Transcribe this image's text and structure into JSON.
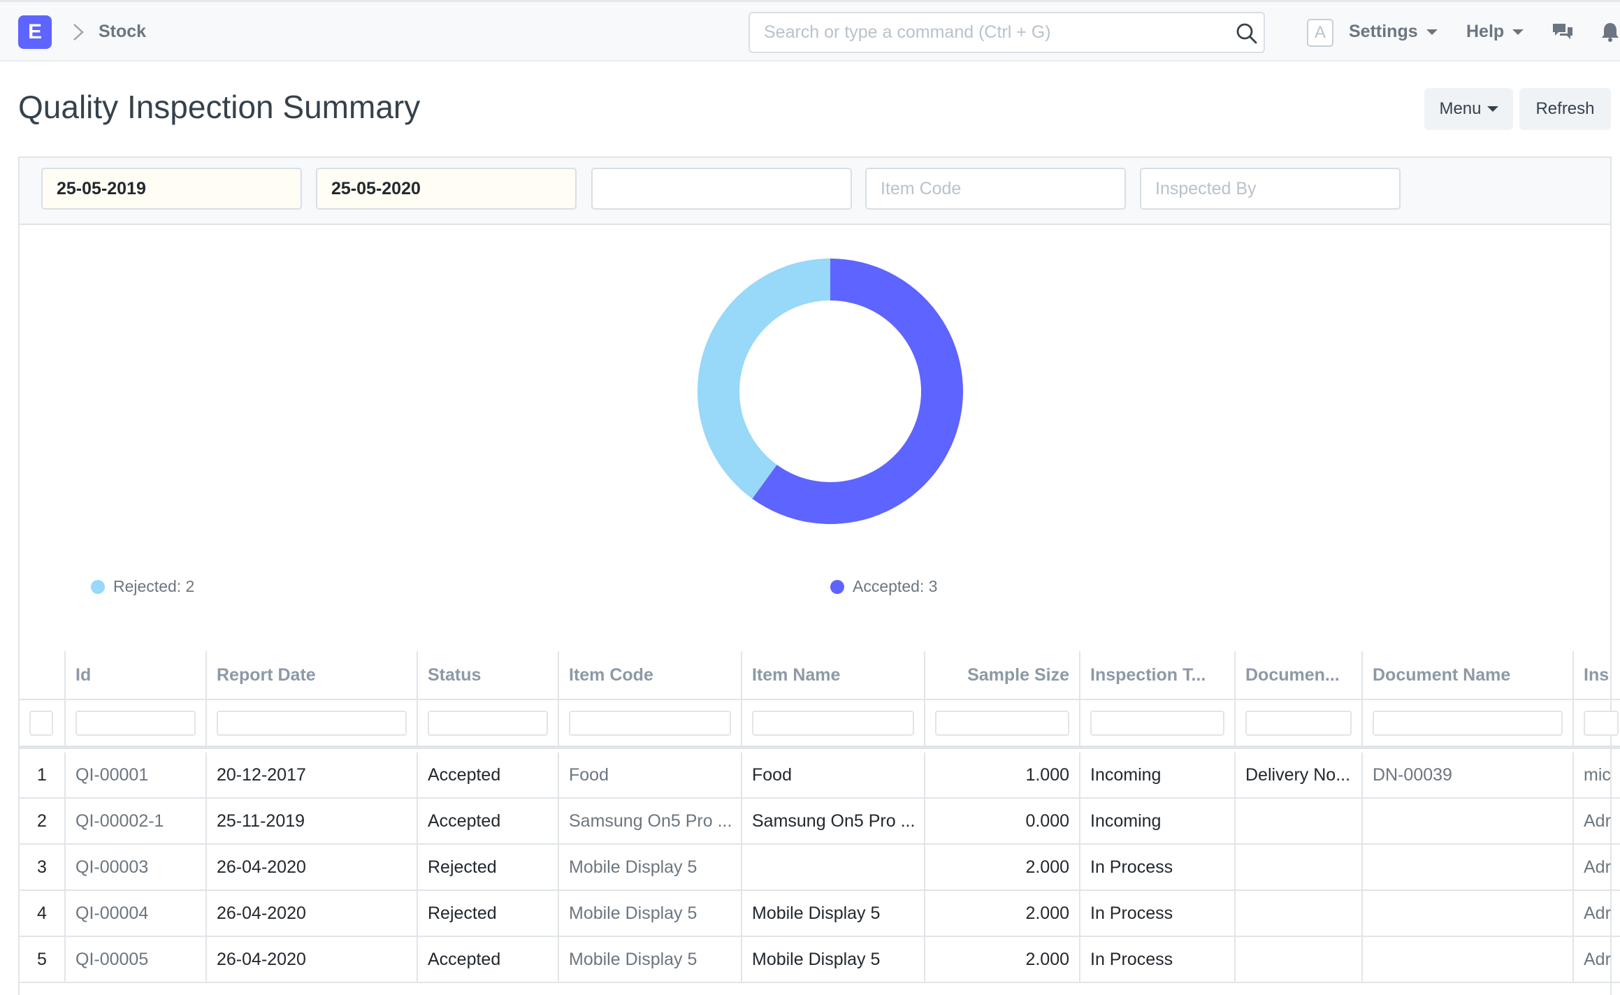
{
  "navbar": {
    "logo": "E",
    "breadcrumb": "Stock",
    "search_placeholder": "Search or type a command (Ctrl + G)",
    "avatar": "A",
    "settings": "Settings",
    "help": "Help"
  },
  "page": {
    "title": "Quality Inspection Summary",
    "menu_label": "Menu",
    "refresh_label": "Refresh"
  },
  "filters": {
    "from_date": "25-05-2019",
    "to_date": "25-05-2020",
    "status_value": "",
    "item_code_placeholder": "Item Code",
    "inspected_by_placeholder": "Inspected By"
  },
  "chart_data": {
    "type": "pie",
    "labels": [
      "Accepted",
      "Rejected"
    ],
    "values": [
      3,
      2
    ],
    "colors": [
      "#5e64ff",
      "#98d8f9"
    ],
    "legend": [
      "Rejected: 2",
      "Accepted: 3"
    ]
  },
  "colors": {
    "accent": "#5e64ff",
    "accepted": "#5e64ff",
    "rejected": "#98d8f9"
  },
  "table": {
    "columns": [
      "",
      "Id",
      "Report Date",
      "Status",
      "Item Code",
      "Item Name",
      "Sample Size",
      "Inspection T...",
      "Documen...",
      "Document Name",
      "Ins"
    ],
    "rows": [
      [
        "1",
        "QI-00001",
        "20-12-2017",
        "Accepted",
        "Food",
        "Food",
        "1.000",
        "Incoming",
        "Delivery No...",
        "DN-00039",
        "mic"
      ],
      [
        "2",
        "QI-00002-1",
        "25-11-2019",
        "Accepted",
        "Samsung On5 Pro ...",
        "Samsung On5 Pro ...",
        "0.000",
        "Incoming",
        "",
        "",
        "Adr"
      ],
      [
        "3",
        "QI-00003",
        "26-04-2020",
        "Rejected",
        "Mobile Display 5",
        "",
        "2.000",
        "In Process",
        "",
        "",
        "Adr"
      ],
      [
        "4",
        "QI-00004",
        "26-04-2020",
        "Rejected",
        "Mobile Display 5",
        "Mobile Display 5",
        "2.000",
        "In Process",
        "",
        "",
        "Adr"
      ],
      [
        "5",
        "QI-00005",
        "26-04-2020",
        "Accepted",
        "Mobile Display 5",
        "Mobile Display 5",
        "2.000",
        "In Process",
        "",
        "",
        "Adr"
      ]
    ]
  }
}
